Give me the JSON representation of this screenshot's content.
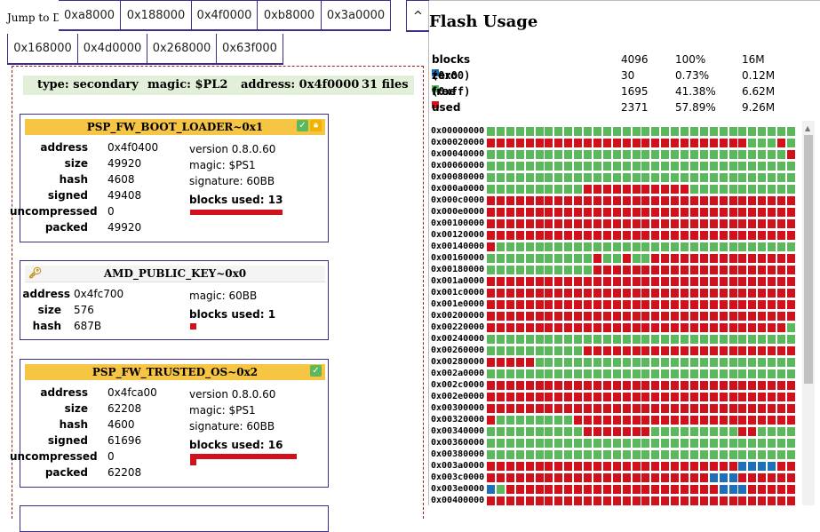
{
  "jump": {
    "label": "Jump to Dir",
    "row1": [
      "0xa8000",
      "0x188000",
      "0x4f0000",
      "0xb8000",
      "0x3a0000"
    ],
    "row2": [
      "0x168000",
      "0x4d0000",
      "0x268000",
      "0x63f000"
    ],
    "collapse": "^"
  },
  "directory": {
    "type": "type: secondary",
    "magic": "magic: $PL2",
    "address": "address: 0x4f0000",
    "files": "31 files"
  },
  "entries": [
    {
      "title": "PSP_FW_BOOT_LOADER~0x1",
      "style": "yellow",
      "icons": [
        "check-icon",
        "lock-icon"
      ],
      "rows": [
        {
          "k": "address",
          "v": "0x4f0400"
        },
        {
          "k": "size",
          "v": "49920"
        },
        {
          "k": "hash",
          "v": "4608"
        },
        {
          "k": "signed",
          "v": "49408"
        },
        {
          "k": "uncompressed",
          "v": "0"
        },
        {
          "k": "packed",
          "v": "49920"
        }
      ],
      "side": [
        "version 0.8.0.60",
        "magic: $PS1",
        "signature: 60BB"
      ],
      "blocks_used": "blocks used: 13",
      "blocks": 13
    },
    {
      "title": "AMD_PUBLIC_KEY~0x0",
      "style": "plain",
      "icons": [
        "key-icon"
      ],
      "rows": [
        {
          "k": "address",
          "v": "0x4fc700"
        },
        {
          "k": "size",
          "v": "576"
        },
        {
          "k": "hash",
          "v": "687B"
        }
      ],
      "side": [
        "magic: 60BB"
      ],
      "blocks_used": "blocks used: 1",
      "blocks": 1
    },
    {
      "title": "PSP_FW_TRUSTED_OS~0x2",
      "style": "yellow",
      "icons": [
        "check-icon"
      ],
      "rows": [
        {
          "k": "address",
          "v": "0x4fca00"
        },
        {
          "k": "size",
          "v": "62208"
        },
        {
          "k": "hash",
          "v": "4600"
        },
        {
          "k": "signed",
          "v": "61696"
        },
        {
          "k": "uncompressed",
          "v": "0"
        },
        {
          "k": "packed",
          "v": "62208"
        }
      ],
      "side": [
        "version 0.8.0.60",
        "magic: $PS1",
        "signature: 60BB"
      ],
      "blocks_used": "blocks used: 16",
      "blocks": 16
    }
  ],
  "flash": {
    "title": "Flash Usage",
    "summary": [
      {
        "label": "blocks",
        "count": "4096",
        "pct": "100%",
        "size": "16M",
        "color": ""
      },
      {
        "label": "zero",
        "code": "(0x00)",
        "count": "30",
        "pct": "0.73%",
        "size": "0.12M",
        "color": "#1f6fb8"
      },
      {
        "label": "free",
        "code": "(0xff)",
        "count": "1695",
        "pct": "41.38%",
        "size": "6.62M",
        "color": "#5cb85c"
      },
      {
        "label": "used",
        "count": "2371",
        "pct": "57.89%",
        "size": "9.26M",
        "color": "#d0101b"
      }
    ],
    "colors": {
      "free": "#5cb85c",
      "used": "#d0101b",
      "zero": "#1f6fb8"
    },
    "addresses": [
      "0x00000000",
      "0x00020000",
      "0x00040000",
      "0x00060000",
      "0x00080000",
      "0x000a0000",
      "0x000c0000",
      "0x000e0000",
      "0x00100000",
      "0x00120000",
      "0x00140000",
      "0x00160000",
      "0x00180000",
      "0x001a0000",
      "0x001c0000",
      "0x001e0000",
      "0x00200000",
      "0x00220000",
      "0x00240000",
      "0x00260000",
      "0x00280000",
      "0x002a0000",
      "0x002c0000",
      "0x002e0000",
      "0x00300000",
      "0x00320000",
      "0x00340000",
      "0x00360000",
      "0x00380000",
      "0x003a0000",
      "0x003c0000",
      "0x003e0000",
      "0x00400000"
    ],
    "grid": [
      "GGGGGGGGGGGGGGGGGGGGGGGGGGGGGGGG",
      "RRRRRRRRRRRRRRRRRRRRRRRRRRRGGGRGGGGGGGGGG",
      "GGGGGGGGGGGGGGGGGGGGGGGGGGGGGGGRGGGGGGGGG",
      "GGGGGGGGGGGGGGGGGGGGGGGGGGGGGGGGGGGGGGGGG",
      "GGGGGGGGGGGGGGGGGGGGGGGGGGGGGGGGGGGGGGGGG",
      "GGGGGGGGGGRRRRRRRRRRRGGGGGGGGGGGGGGGGGGGG",
      "RRRRRRRRRRRRRRRRRRRRRRRRRRRRRRRRRRRRRRRRR",
      "RRRRRRRRRRRRRRRRRRRRRRRRRRRRRRRRRRRRRRRRR",
      "RRRRRRRRRRRRRRRRRRRRRRRRRRRRRRRRRRRRRRRRR",
      "RRRRRRRRRRRRRRRRRRRRRRRRRRRRRRRRRRRRRRRRR",
      "RGGGGGGGGGGGGGGGGGGGGGGGGGGGGGGGGGGGGGGGG",
      "GGGGGGGGGGGRGGRGGRRRRRRRRRRRRRRRRRRRRRRRR",
      "GGGGGGGGGGGRRRRRRRRRRRRRRRRRRRRRRRRRRRRRR",
      "RRRRRRRRRRRRRRRRRRRRRRRRRRRRRRRRRRRRRRRRR",
      "RRRRRRRRRRRRRRRRRRRRRRRRRRRRRRRRRRRRRRRRG",
      "RRRRRRRRRRRRRRRRRRRRRRRRRRRRRRRRRRRRRRRRR",
      "RRRRRRRRRRRRRRRRRRRRRRRRRRRRRRRRRRRRRRRRR",
      "RRRRRRRRRRRRRRRRRRRRRRRRRRRRRRRGGGGGGGGGG",
      "GGGGGGGGGGGGGGGGGGGGGGGGGGGGGGGGGGGGGGGGG",
      "GGGGGGGGGGRRRRRRRRRRRRRRRRRRRRRRRRRRRRRRR",
      "RRRRRGGGGGGGGGGGGGGGGGGGGGGGGGGGGGGGGGGGG",
      "GGGGGGGGGGGGGGGGGGGGGGGGGGGGGGGGGGGGGGGGG",
      "RRRRRRRRRRRRRRRRRRRRRRRRRRRRRRRRRRRRRRRRR",
      "RRRRRRRRRRRRRRRRRRRRRRRRRRRRRRRRRRRGGGGGG",
      "RRRRRRRRRRRRRRRRRRRRRRRRRRRRRRRRRRRRGGRRR",
      "RGGGGGGGGRRRRRRRRRRRRRRRRRRRRRRRRRRRGGGGG",
      "GGGGGGGGGGRRRRRRRGGGGGGGGGRRGGGGGGGGGGGGG",
      "GGGGGGGGGGGGGGGGGGGGGGGGGGGGGGGGGGGGGGGGG",
      "GGGGGGGGGGGGGGGGGGGGGGGGGGGGGGGGGGGGGGGGG",
      "RRRRRRRRRRRRRRRRRRRRRRRRRRBBBBRRRRRRRRRRR",
      "RRRRRRRRRRRRRRRRRRRRRRRBBBRRRRRRRBBBBBBBB",
      "BGRRRRRRRRRRRRRRRRRRRRRRBBBRRRRRRRRRRRRRR",
      "RRRRRRRRRRRRRRRRRRRRRRRRRRRRRRRRRRRRRRRRR"
    ]
  }
}
